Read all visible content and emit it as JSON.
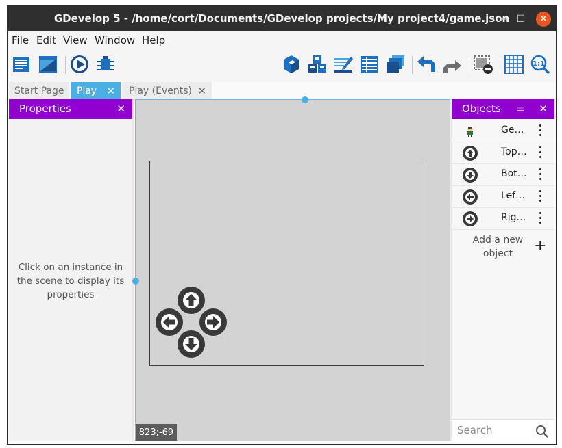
{
  "window": {
    "title": "GDevelop 5 - /home/cort/Documents/GDevelop projects/My project4/game.json"
  },
  "menu": [
    "File",
    "Edit",
    "View",
    "Window",
    "Help"
  ],
  "toolbar": {
    "left": [
      "project-manager-icon",
      "scene-properties-icon",
      "preview-play-icon",
      "debugger-icon"
    ],
    "right": [
      "object-3d-icon",
      "object-groups-icon",
      "edit-object-icon",
      "instances-list-icon",
      "layers-icon",
      "undo-icon",
      "redo-icon",
      "toggle-window-mask-icon",
      "toggle-grid-icon",
      "zoom-reset-icon"
    ]
  },
  "tabs": [
    {
      "label": "Start Page",
      "active": false,
      "closable": false
    },
    {
      "label": "Play",
      "active": true,
      "closable": true
    },
    {
      "label": "Play (Events)",
      "active": false,
      "closable": true
    }
  ],
  "properties": {
    "title": "Properties",
    "empty_line1": "Click on an instance in",
    "empty_line2": "the scene to display its",
    "empty_line3": "properties"
  },
  "scene": {
    "cursor_coords": "823;-69"
  },
  "objects": {
    "title": "Objects",
    "items": [
      {
        "name": "Ge…",
        "icon": "character-sprite-icon"
      },
      {
        "name": "Top…",
        "icon": "arrow-up-icon"
      },
      {
        "name": "Bot…",
        "icon": "arrow-down-icon"
      },
      {
        "name": "Lef…",
        "icon": "arrow-left-icon"
      },
      {
        "name": "Rig…",
        "icon": "arrow-right-icon"
      }
    ],
    "add_line1": "Add a new",
    "add_line2": "object",
    "search_placeholder": "Search"
  },
  "colors": {
    "panel_header": "#9100ce",
    "active_tab": "#4ab0e4",
    "titlebar": "#2f2f2f",
    "close_button": "#e95420"
  }
}
